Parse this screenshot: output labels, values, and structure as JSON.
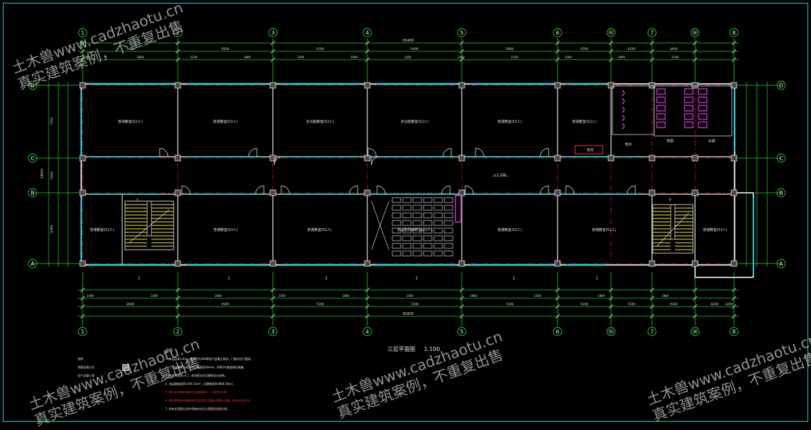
{
  "drawing": {
    "title": "三层平面图",
    "scale": "1:100",
    "overall_dimension": "65400",
    "overall_dimension_bottom": "65800"
  },
  "axes": {
    "vertical": [
      "1",
      "2",
      "3",
      "4",
      "5",
      "6",
      "Ⓝ",
      "7",
      "Ⓜ",
      "8"
    ],
    "horizontal": [
      "D",
      "C",
      "B",
      "A"
    ]
  },
  "dimensions": {
    "top_bays": [
      "3400",
      "9500",
      "4100",
      "5400",
      "5800",
      "4500",
      "4200",
      "3400"
    ],
    "top_segments": [
      "1950",
      "3000",
      "2100",
      "1800",
      "1500",
      "3000",
      "1500",
      "1800",
      "2100",
      "1500",
      "3000",
      "2100"
    ],
    "bottom_bays": [
      "3600",
      "9500",
      "7200",
      "7200",
      "7200",
      "5200",
      "7200",
      "4500",
      "4200",
      "2400"
    ],
    "bottom_segments": [
      "2400",
      "1500",
      "1800",
      "1500",
      "1800",
      "1500",
      "1800",
      "1500",
      "1800",
      "1800"
    ],
    "left": [
      "7350",
      "2400",
      "18900",
      "6360"
    ]
  },
  "rooms": {
    "north": [
      "普通教室(52人)",
      "普通教室(52人)",
      "多功能教室(52人)",
      "多功能教室(52人)",
      "普通教室(52人)",
      "普通教室(52人)"
    ],
    "south": [
      "普通教室(52人)",
      "普通教室(52人)",
      "普通教室(52人)",
      "多功能阶梯教室(52人)",
      "普通教室(52人)",
      "普通教室(52人)",
      "普通教室(52人)"
    ],
    "toilets": [
      "男厕",
      "女厕",
      "管井",
      "管井"
    ],
    "stairs": [
      "上",
      "下"
    ],
    "corridor_level": "±7.200"
  },
  "notes": {
    "heading": "说明：",
    "items": [
      "1. 本层层高3.6m，墙体均为200厚加气混凝土砌块，门窗详见门窗表。",
      "2. 卫生间楼面标高比同层楼面低20mm，并做1%坡度坡向地漏。",
      "3. 楼梯间设防火门，其余做法详见建筑设计说明。",
      "4. 本层建筑面积1290.52m²，总建筑面积3868.56m²。",
      "5. 图中未注明的墙体均以轴线居中，门垛均为120。",
      "6. 图中管井待设备安装完毕后用C20细石混凝土封堵，做法详见大样。",
      "7. 所有外墙窗台及外墙装饰详见立面图及墙身大样。"
    ],
    "legend": [
      {
        "label": "图例"
      },
      {
        "label": "钢筋混凝土柱"
      },
      {
        "label": "加气混凝土墙"
      }
    ]
  },
  "watermark": {
    "line1": "土木兽www.cadzhaotu.cn",
    "line2": "真实建筑案例，不重复出售"
  },
  "colors": {
    "background": "#000000",
    "axis": "#21d821",
    "wall": "#c9c9c9",
    "window": "#22d6e0",
    "column": "#ff4fd0",
    "red": "#ff3030",
    "magenta": "#ff3cff",
    "yellow": "#f4f03c",
    "frame": "#1fd0d0"
  }
}
